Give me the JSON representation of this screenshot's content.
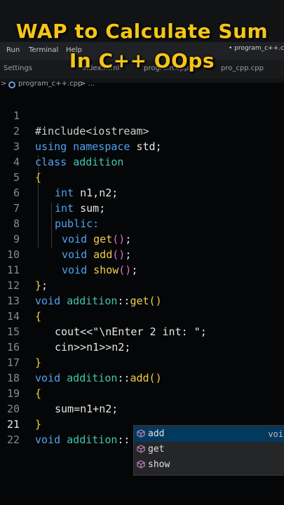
{
  "overlay_title": {
    "line1": "WAP to Calculate Sum",
    "line2": "In C++ OOps",
    "color": "#f5c518"
  },
  "menubar": {
    "items": [
      "Run",
      "Terminal",
      "Help"
    ],
    "right_tab": "• program_c++.cpp"
  },
  "tabs": {
    "settings": "Settings",
    "index": "index.html",
    "program": "program.cpp",
    "pro": "pro_cpp.cpp"
  },
  "breadcrumb": {
    "arrow": ">",
    "file": "program_c++.cpp",
    "tail": "> ..."
  },
  "editor": {
    "lines": [
      {
        "n": "1",
        "text": "#include<iostream>"
      },
      {
        "n": "2",
        "text": "using namespace std;"
      },
      {
        "n": "3",
        "text": "class addition"
      },
      {
        "n": "4",
        "text": "{"
      },
      {
        "n": "5",
        "text": "int n1,n2;"
      },
      {
        "n": "6",
        "text": "int sum;"
      },
      {
        "n": "7",
        "text": "public:"
      },
      {
        "n": "8",
        "text": "void get();"
      },
      {
        "n": "9",
        "text": "void add();"
      },
      {
        "n": "10",
        "text": "void show();"
      },
      {
        "n": "11",
        "text": "};"
      },
      {
        "n": "12",
        "text": "void addition::get()"
      },
      {
        "n": "13",
        "text": "{"
      },
      {
        "n": "14",
        "text": "cout<<\"\\nEnter 2 int: \";"
      },
      {
        "n": "15",
        "text": "cin>>n1>>n2;"
      },
      {
        "n": "16",
        "text": "}"
      },
      {
        "n": "17",
        "text": "void addition::add()"
      },
      {
        "n": "18",
        "text": "{"
      },
      {
        "n": "19",
        "text": "sum=n1+n2;"
      },
      {
        "n": "20",
        "text": "}"
      },
      {
        "n": "21",
        "text": "void addition::"
      },
      {
        "n": "22",
        "text": ""
      }
    ],
    "active_line": "21"
  },
  "suggestions": {
    "items": [
      {
        "label": "add",
        "detail": "voi",
        "icon": "method-cube-icon"
      },
      {
        "label": "get",
        "detail": "",
        "icon": "method-cube-icon"
      },
      {
        "label": "show",
        "detail": "",
        "icon": "method-cube-icon"
      }
    ],
    "selected_color": "#04395e"
  }
}
